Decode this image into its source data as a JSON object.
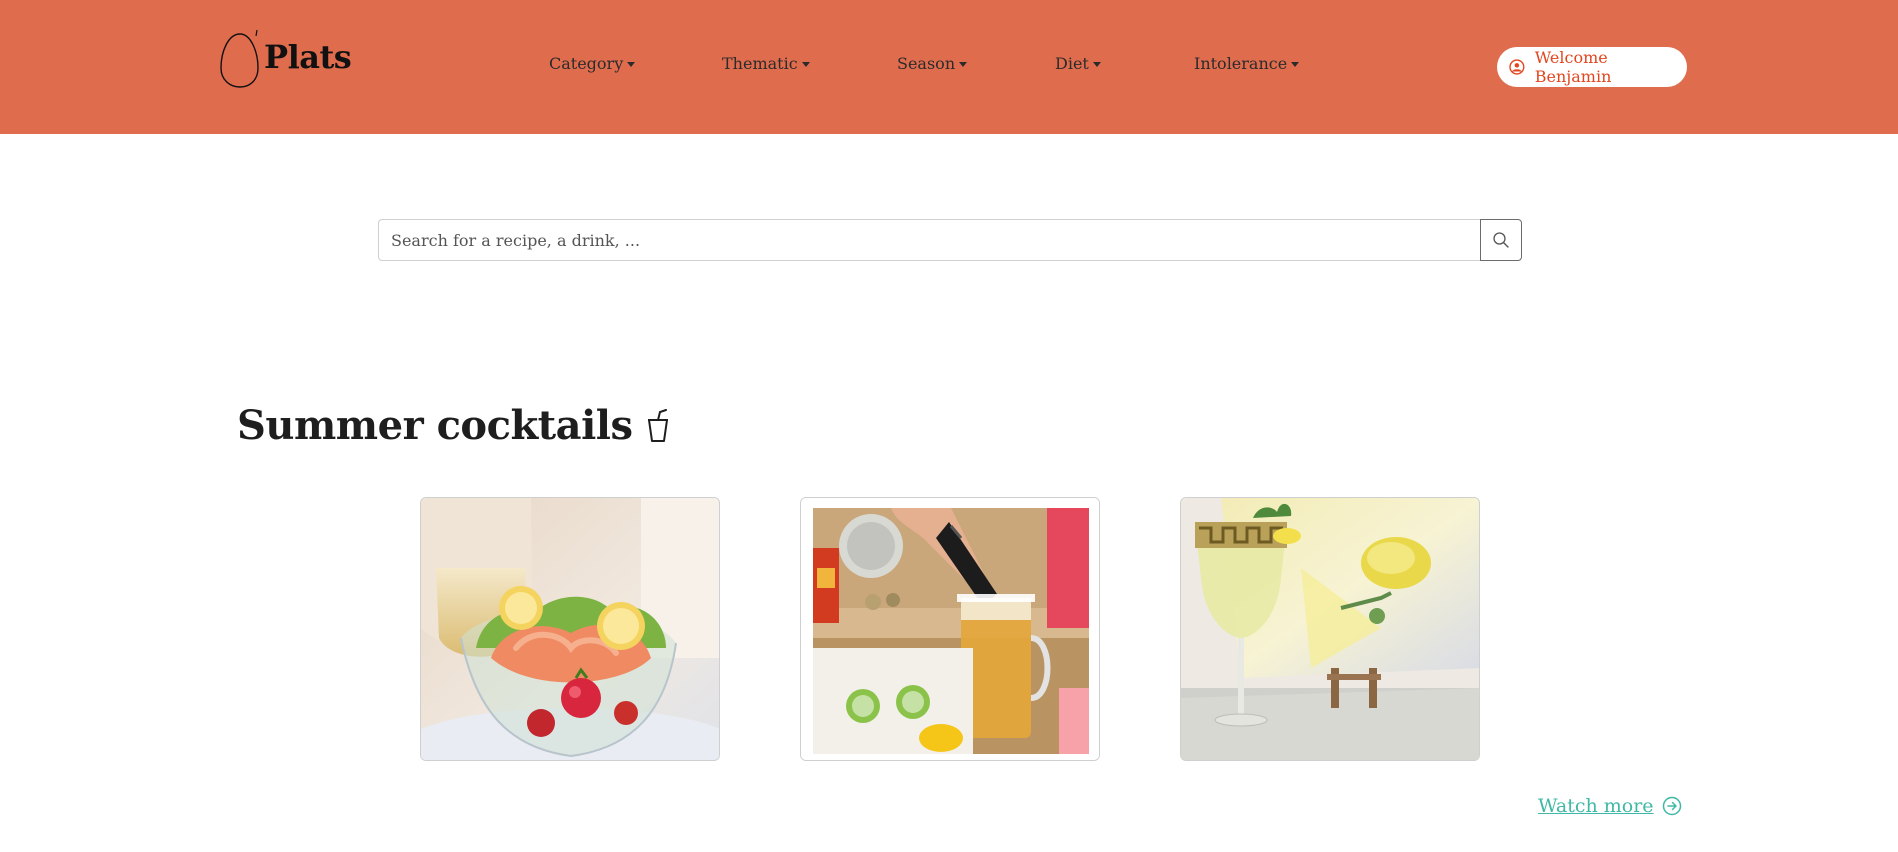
{
  "brand": {
    "name": "Plats",
    "logo_icon": "egg-icon"
  },
  "nav": {
    "items": [
      {
        "label": "Category"
      },
      {
        "label": "Thematic"
      },
      {
        "label": "Season"
      },
      {
        "label": "Diet"
      },
      {
        "label": "Intolerance"
      }
    ],
    "welcome_label": "Welcome Benjamin",
    "welcome_icon": "user-circle-icon"
  },
  "search": {
    "placeholder": "Search for a recipe, a drink, ...",
    "value": "",
    "button_icon": "search-icon"
  },
  "section": {
    "title": "Summer cocktails",
    "title_icon": "cup-with-straw-icon"
  },
  "cards": [
    {
      "image": "shrimp-cocktail-photo"
    },
    {
      "image": "pouring-beer-michelada-photo"
    },
    {
      "image": "lemonade-glass-with-painting-photo"
    }
  ],
  "watch_more": {
    "label": "Watch more",
    "icon": "arrow-right-circle-icon"
  },
  "colors": {
    "navbar": "#e06c4e",
    "welcome_text": "#e2461f",
    "link": "#3fb8a6"
  }
}
